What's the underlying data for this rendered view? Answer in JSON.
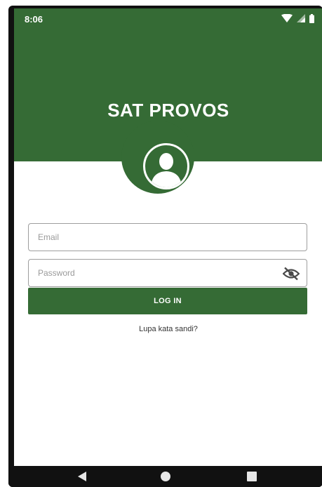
{
  "status_bar": {
    "time": "8:06"
  },
  "app": {
    "title": "SAT PROVOS"
  },
  "form": {
    "email_placeholder": "Email",
    "password_placeholder": "Password",
    "login_label": "LOG IN",
    "forgot_label": "Lupa kata sandi?"
  },
  "colors": {
    "primary": "#356b35",
    "background": "#ffffff",
    "nav_bar": "#111111"
  },
  "icons": {
    "status": [
      "wifi-icon",
      "signal-icon",
      "battery-icon"
    ],
    "avatar": "user-avatar-icon",
    "password_toggle": "eye-slash-icon",
    "nav": [
      "back-icon",
      "home-icon",
      "recents-icon"
    ]
  }
}
